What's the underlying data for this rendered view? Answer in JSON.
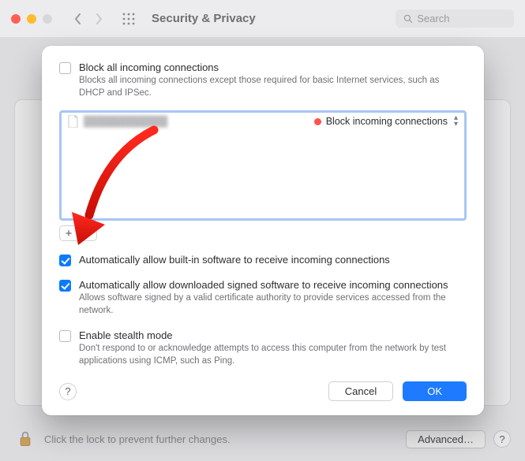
{
  "window": {
    "title": "Security & Privacy",
    "search_placeholder": "Search"
  },
  "sheet": {
    "block_all": {
      "label": "Block all incoming connections",
      "desc": "Blocks all incoming connections except those required for basic Internet services, such as DHCP and IPSec.",
      "checked": false
    },
    "app_row": {
      "status_label": "Block incoming connections"
    },
    "auto_builtin": {
      "label": "Automatically allow built-in software to receive incoming connections",
      "checked": true
    },
    "auto_signed": {
      "label": "Automatically allow downloaded signed software to receive incoming connections",
      "desc": "Allows software signed by a valid certificate authority to provide services accessed from the network.",
      "checked": true
    },
    "stealth": {
      "label": "Enable stealth mode",
      "desc": "Don't respond to or acknowledge attempts to access this computer from the network by test applications using ICMP, such as Ping.",
      "checked": false
    },
    "buttons": {
      "cancel": "Cancel",
      "ok": "OK"
    }
  },
  "footer": {
    "lock_text": "Click the lock to prevent further changes.",
    "advanced": "Advanced…"
  }
}
